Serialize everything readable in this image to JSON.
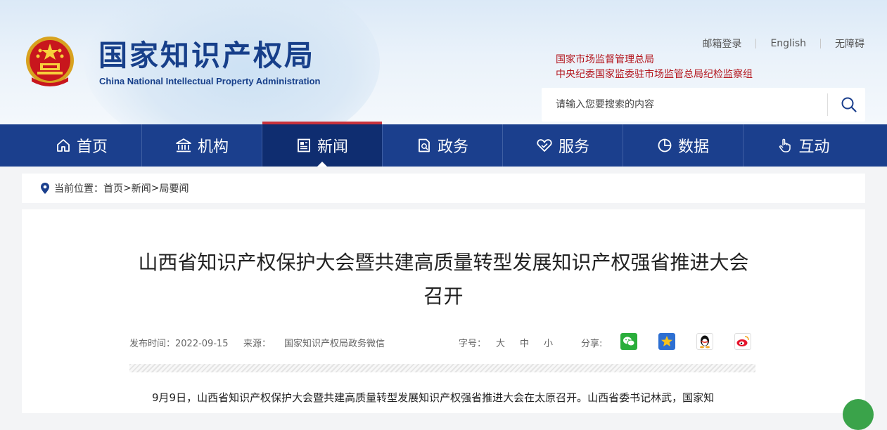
{
  "header": {
    "logo_cn": "国家知识产权局",
    "logo_en": "China National Intellectual Property Administration",
    "links": [
      "邮箱登录",
      "English",
      "无障碍"
    ],
    "agency_lines": [
      "国家市场监督管理总局",
      "中央纪委国家监委驻市场监管总局纪检监察组"
    ],
    "search_placeholder": "请输入您要搜索的内容"
  },
  "nav": {
    "items": [
      {
        "label": "首页",
        "icon": "home-icon"
      },
      {
        "label": "机构",
        "icon": "institution-icon"
      },
      {
        "label": "新闻",
        "icon": "news-icon",
        "active": true
      },
      {
        "label": "政务",
        "icon": "government-affairs-icon"
      },
      {
        "label": "服务",
        "icon": "service-heart-icon"
      },
      {
        "label": "数据",
        "icon": "pie-chart-icon"
      },
      {
        "label": "互动",
        "icon": "hand-pointer-icon"
      }
    ]
  },
  "breadcrumb": {
    "prefix": "当前位置：",
    "items": [
      "首页",
      "新闻",
      "局要闻"
    ],
    "separator": ">"
  },
  "article": {
    "title_line1": "山西省知识产权保护大会暨共建高质量转型发展知识产权强省推进大会",
    "title_line2": "召开",
    "publish_label": "发布时间：",
    "publish_date": "2022-09-15",
    "source_label": "来源：",
    "source": "国家知识产权局政务微信",
    "fontsize_label": "字号：",
    "fontsize_options": [
      "大",
      "中",
      "小"
    ],
    "share_label": "分享:",
    "share_icons": [
      "wechat-icon",
      "qzone-star-icon",
      "qq-penguin-icon",
      "weibo-icon"
    ],
    "body_first_line": "9月9日，山西省知识产权保护大会暨共建高质量转型发展知识产权强省推进大会在太原召开。山西省委书记林武，国家知"
  },
  "colors": {
    "nav_bg": "#1b3f8d",
    "nav_active_bg": "#0f2d70",
    "accent_red": "#c8323c",
    "logo_blue": "#173f8a",
    "agency_red": "#b3141c"
  }
}
